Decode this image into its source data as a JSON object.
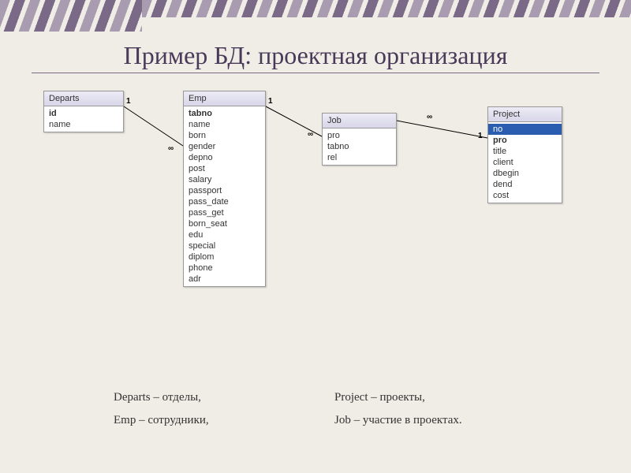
{
  "title": "Пример БД: проектная организация",
  "tables": {
    "departs": {
      "name": "Departs",
      "fields": [
        {
          "label": "id",
          "bold": true
        },
        {
          "label": "name",
          "bold": false
        }
      ]
    },
    "emp": {
      "name": "Emp",
      "fields": [
        {
          "label": "tabno",
          "bold": true
        },
        {
          "label": "name"
        },
        {
          "label": "born"
        },
        {
          "label": "gender"
        },
        {
          "label": "depno"
        },
        {
          "label": "post"
        },
        {
          "label": "salary"
        },
        {
          "label": "passport"
        },
        {
          "label": "pass_date"
        },
        {
          "label": "pass_get"
        },
        {
          "label": "born_seat"
        },
        {
          "label": "edu"
        },
        {
          "label": "special"
        },
        {
          "label": "diplom"
        },
        {
          "label": "phone"
        },
        {
          "label": "adr"
        }
      ]
    },
    "job": {
      "name": "Job",
      "fields": [
        {
          "label": "pro"
        },
        {
          "label": "tabno"
        },
        {
          "label": "rel"
        }
      ]
    },
    "project": {
      "name": "Project",
      "fields": [
        {
          "label": "no",
          "selected": true
        },
        {
          "label": "pro",
          "bold": true
        },
        {
          "label": "title"
        },
        {
          "label": "client"
        },
        {
          "label": "dbegin"
        },
        {
          "label": "dend"
        },
        {
          "label": "cost"
        }
      ]
    }
  },
  "relations": {
    "departs_emp": {
      "from": "1",
      "to": "∞"
    },
    "emp_job": {
      "from": "1",
      "to": "∞"
    },
    "job_project": {
      "from": "∞",
      "to": "1"
    }
  },
  "legend": {
    "departs": "Departs – отделы,",
    "project": "Project – проекты,",
    "emp": "Emp – сотрудники,",
    "job": "Job – участие в проектах."
  }
}
